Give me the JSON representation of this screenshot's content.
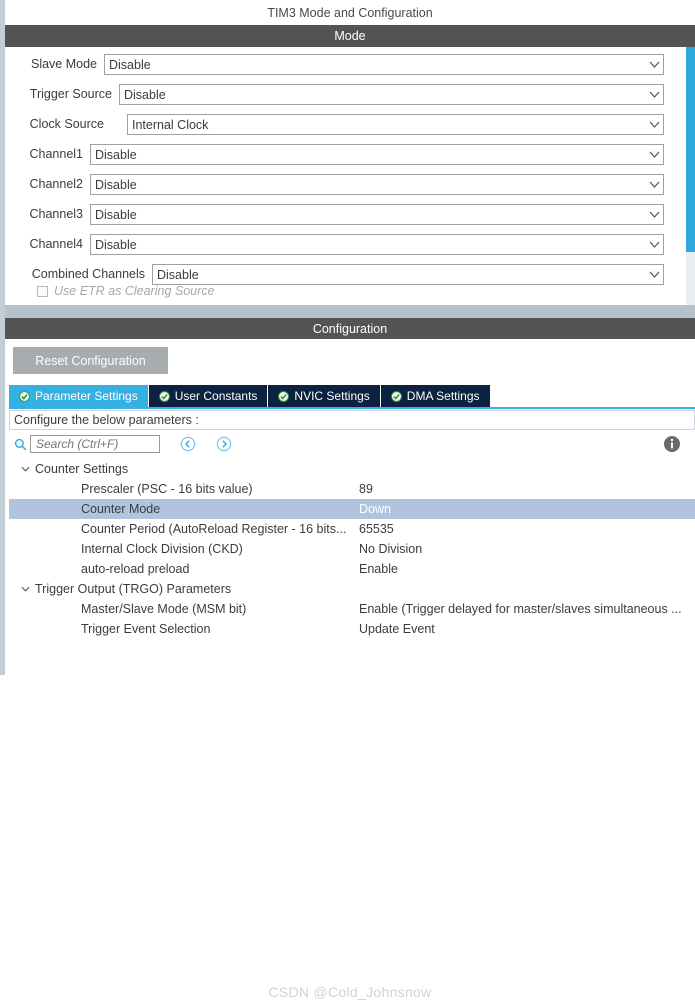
{
  "window": {
    "title": "TIM3 Mode and Configuration"
  },
  "mode": {
    "header": "Mode",
    "rows": [
      {
        "label": "Slave Mode",
        "value": "Disable"
      },
      {
        "label": "Trigger Source",
        "value": "Disable"
      },
      {
        "label": "Clock Source",
        "value": "Internal Clock"
      },
      {
        "label": "Channel1",
        "value": "Disable"
      },
      {
        "label": "Channel2",
        "value": "Disable"
      },
      {
        "label": "Channel3",
        "value": "Disable"
      },
      {
        "label": "Channel4",
        "value": "Disable"
      },
      {
        "label": "Combined Channels",
        "value": "Disable"
      }
    ],
    "checkbox": {
      "label": "Use ETR as Clearing Source",
      "checked": false,
      "enabled": false
    }
  },
  "configuration": {
    "header": "Configuration",
    "reset_label": "Reset Configuration",
    "tabs": [
      {
        "label": "Parameter Settings",
        "active": true
      },
      {
        "label": "User Constants",
        "active": false
      },
      {
        "label": "NVIC Settings",
        "active": false
      },
      {
        "label": "DMA Settings",
        "active": false
      }
    ],
    "note": "Configure the below parameters :",
    "search": {
      "placeholder": "Search (Ctrl+F)",
      "value": ""
    },
    "icons": {
      "search": "search-icon",
      "back": "back-arrow-icon",
      "forward": "forward-arrow-icon",
      "info": "info-icon"
    },
    "tree": [
      {
        "type": "group",
        "name": "Counter Settings",
        "value": "",
        "expanded": true,
        "selected": false
      },
      {
        "type": "item",
        "name": "Prescaler (PSC - 16 bits value)",
        "value": "89",
        "selected": false
      },
      {
        "type": "item",
        "name": "Counter Mode",
        "value": "Down",
        "selected": true
      },
      {
        "type": "item",
        "name": "Counter Period (AutoReload Register - 16 bits...",
        "value": "65535",
        "selected": false
      },
      {
        "type": "item",
        "name": "Internal Clock Division (CKD)",
        "value": "No Division",
        "selected": false
      },
      {
        "type": "item",
        "name": "auto-reload preload",
        "value": "Enable",
        "selected": false
      },
      {
        "type": "group",
        "name": "Trigger Output (TRGO) Parameters",
        "value": "",
        "expanded": true,
        "selected": false
      },
      {
        "type": "item",
        "name": "Master/Slave Mode (MSM bit)",
        "value": "Enable (Trigger delayed for master/slaves simultaneous ...",
        "selected": false
      },
      {
        "type": "item",
        "name": "Trigger Event Selection",
        "value": "Update Event",
        "selected": false
      }
    ]
  },
  "watermark": {
    "text": "CSDN @Cold_Johnsnow"
  },
  "colors": {
    "header_bar": "#545454",
    "tab_active": "#36b0e2",
    "tab_inactive": "#0d2240",
    "selection": "#b0c4de",
    "scrollbar": "#2fa8e0",
    "reset_button": "#a7acaf"
  }
}
